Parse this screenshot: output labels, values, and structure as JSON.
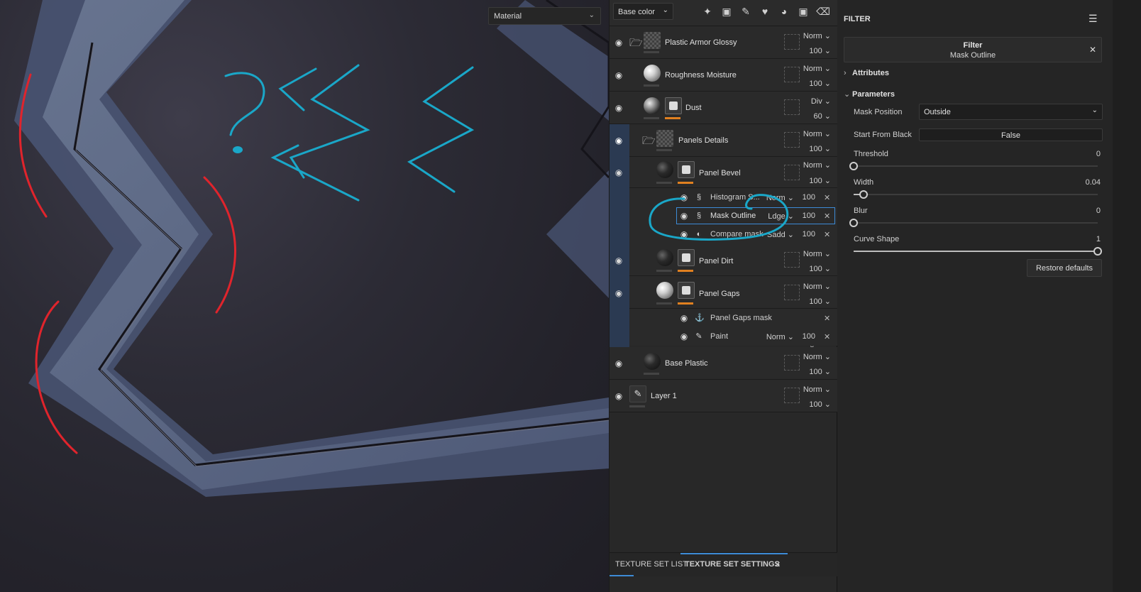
{
  "viewport": {
    "material_select": "Material"
  },
  "layers_panel": {
    "channel_select": "Base color",
    "toolbar_icons": [
      "magic-wand-icon",
      "mask-icon",
      "brush-icon",
      "fill-icon",
      "palette-icon",
      "folder-icon",
      "trash-icon"
    ],
    "layers": [
      {
        "name": "Plastic Armor Glossy",
        "blend": "Norm",
        "opacity": "100"
      },
      {
        "name": "Roughness Moisture",
        "blend": "Norm",
        "opacity": "100"
      },
      {
        "name": "Dust",
        "blend": "Div",
        "opacity": "60"
      },
      {
        "name": "Panels Details",
        "blend": "Norm",
        "opacity": "100"
      },
      {
        "name": "Panel Bevel",
        "blend": "Norm",
        "opacity": "100"
      },
      {
        "name": "Panel Dirt",
        "blend": "Norm",
        "opacity": "100"
      },
      {
        "name": "Panel Gaps",
        "blend": "Norm",
        "opacity": "100"
      },
      {
        "name": "Base Plastic",
        "blend": "Norm",
        "opacity": "100"
      },
      {
        "name": "Layer 1",
        "blend": "Norm",
        "opacity": "100"
      }
    ],
    "sub_items": [
      {
        "name": "Histogram S...",
        "blend": "Norm",
        "opacity": "100"
      },
      {
        "name": "Mask Outline",
        "blend": "Ldge",
        "opacity": "100"
      },
      {
        "name": "Compare mask",
        "blend": "Sadd",
        "opacity": "100"
      },
      {
        "name": "Panel Gaps mask",
        "blend": "",
        "opacity": ""
      },
      {
        "name": "Paint",
        "blend": "Norm",
        "opacity": "100"
      }
    ],
    "tabs": [
      "TEXTURE SET LIST",
      "TEXTURE SET SETTINGS"
    ]
  },
  "properties": {
    "title": "FILTER",
    "filter_label": "Filter",
    "filter_name": "Mask Outline",
    "sections": [
      "Attributes",
      "Parameters"
    ],
    "mask_position_label": "Mask Position",
    "mask_position_value": "Outside",
    "start_from_black_label": "Start From Black",
    "start_from_black_value": "False",
    "threshold_label": "Threshold",
    "threshold_value": "0",
    "width_label": "Width",
    "width_value": "0.04",
    "blur_label": "Blur",
    "blur_value": "0",
    "curve_label": "Curve Shape",
    "curve_value": "1",
    "restore_label": "Restore defaults"
  },
  "sliders": {
    "threshold": 0,
    "width": 0.04,
    "blur": 0,
    "curve_shape": 1
  },
  "colors": {
    "accent": "#3d8bd6",
    "annotation_cyan": "#1aa7c8",
    "annotation_red": "#e0242c",
    "orange_bar": "#e08020"
  }
}
